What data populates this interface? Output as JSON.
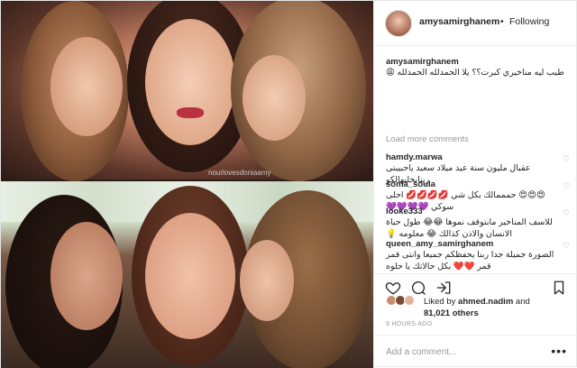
{
  "photo": {
    "watermark": "nourlovesdoniaamy"
  },
  "header": {
    "username": "amysamirghanem",
    "separator": "•",
    "follow_status": "Following"
  },
  "caption": {
    "username": "amysamirghanem",
    "text": "طيب ليه مناخيري كبرت؟؟ يلا الحمدلله الحمدلله 😩"
  },
  "load_more": "Load more comments",
  "comments": [
    {
      "username": "hamdy.marwa",
      "text": "عقبال مليون سنة عيد ميلاد سعيد ياحبيبتى ربنايخليهالكو"
    },
    {
      "username": "soma_soula",
      "text": "😍😍😍 حمممالك بكل شي 💋💋💋💋 احلى سوكي 💜💜💜💜"
    },
    {
      "username": "looke333",
      "text": "للاسف المناخير مابتوقف نموها 😂😂 طول حياة الانسان والاذن كذالك 😂 معلومه 💡"
    },
    {
      "username": "queen_amy_samirghanem",
      "text": "الصورة جميلة جدا ربنا يحفظكم جميعا وانتى قمر قمر ❤️❤️ بكل حالاتك يا حلوه"
    }
  ],
  "likes": {
    "prefix": "Liked by",
    "user": "ahmed.nadim",
    "and": "and",
    "count": "81,021 others"
  },
  "timestamp": "9 HOURS AGO",
  "add_comment": {
    "placeholder": "Add a comment...",
    "more": "•••"
  },
  "icons": [
    "heart-icon",
    "comment-icon",
    "share-icon",
    "bookmark-icon"
  ],
  "colors": {
    "text": "#262626",
    "muted": "#999999",
    "border": "#efefef"
  }
}
